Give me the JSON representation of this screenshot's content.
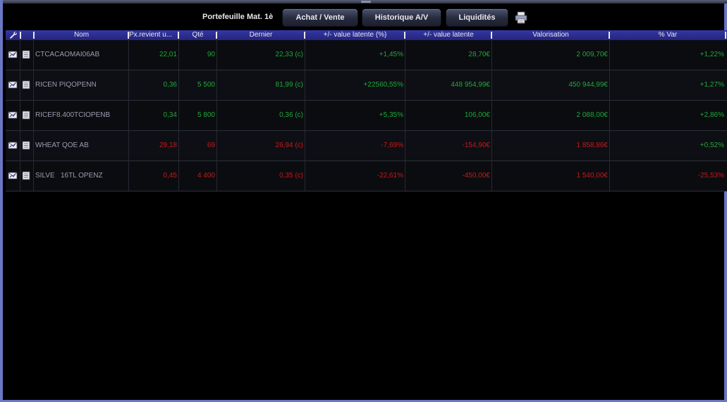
{
  "toolbar": {
    "portfolio_title": "Portefeuille Mat. 1è",
    "buttons": [
      "Achat / Vente",
      "Historique A/V",
      "Liquidités"
    ],
    "print_icon": "printer-icon"
  },
  "table": {
    "header_icon": "wrench-icon",
    "columns": [
      "Nom",
      "Px.revient u...",
      "Qté",
      "Dernier",
      "+/- value latente (%)",
      "+/- value latente",
      "Valorisation",
      "% Var"
    ],
    "row_icons": [
      "chart-envelope-icon",
      "document-icon"
    ],
    "colors": {
      "positive": "#1fa83a",
      "negative": "#c41a1a",
      "name": "#9a9db0"
    },
    "rows": [
      {
        "name": "CTCACAOMAI06AB",
        "prix_revient": "22,01",
        "qte": "90",
        "dernier": "22,33 (c)",
        "pv_pct": "+1,45%",
        "pv": "28,70€",
        "valorisation": "2 009,70€",
        "var": "+1,22%",
        "tone": "pos",
        "var_tone": "pos"
      },
      {
        "name": "RICEN PIQOPENN",
        "prix_revient": "0,36",
        "qte": "5 500",
        "dernier": "81,99 (c)",
        "pv_pct": "+22560,55%",
        "pv": "448 954,99€",
        "valorisation": "450 944,99€",
        "var": "+1,27%",
        "tone": "pos",
        "var_tone": "pos"
      },
      {
        "name": "RICEF8.400TCIOPENB",
        "prix_revient": "0,34",
        "qte": "5 800",
        "dernier": "0,36 (c)",
        "pv_pct": "+5,35%",
        "pv": "106,00€",
        "valorisation": "2 088,00€",
        "var": "+2,86%",
        "tone": "pos",
        "var_tone": "pos"
      },
      {
        "name": "WHEAT QOE AB",
        "prix_revient": "29,18",
        "qte": "69",
        "dernier": "26,94 (c)",
        "pv_pct": "-7,69%",
        "pv": "-154,90€",
        "valorisation": "1 858,86€",
        "var": "+0,52%",
        "tone": "neg",
        "var_tone": "pos"
      },
      {
        "name": "SILVE   16TL OPENZ",
        "prix_revient": "0,45",
        "qte": "4 400",
        "dernier": "0,35 (c)",
        "pv_pct": "-22,61%",
        "pv": "-450,00€",
        "valorisation": "1 540,00€",
        "var": "-25,53%",
        "tone": "neg",
        "var_tone": "neg"
      }
    ]
  }
}
